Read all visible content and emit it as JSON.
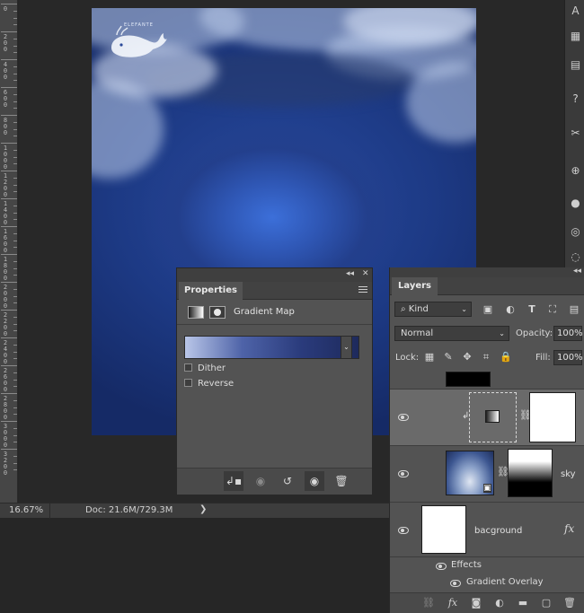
{
  "ruler": {
    "ticks": [
      "0",
      "2 0 0",
      "4 0 0",
      "6 0 0",
      "8 0 0",
      "1 0 0 0",
      "1 2 0 0",
      "1 4 0 0",
      "1 6 0 0",
      "1 8 0 0",
      "2 0 0 0",
      "2 2 0 0",
      "2 4 0 0",
      "2 6 0 0",
      "2 8 0 0",
      "3 0 0 0",
      "3 2 0 0"
    ]
  },
  "canvas": {
    "logo_text": "ELEFANTE"
  },
  "status": {
    "zoom": "16.67%",
    "doc": "Doc: 21.6M/729.3M",
    "arrow": "❯"
  },
  "properties": {
    "tab": "Properties",
    "title": "Gradient Map",
    "collapse": "◂◂",
    "close": "✕",
    "dither": "Dither",
    "reverse": "Reverse",
    "gradient_colors": [
      "#b9c6e8",
      "#4e63a8",
      "#2a3b7c",
      "#1e2a5c"
    ]
  },
  "layers": {
    "tab": "Layers",
    "collapse": "◂◂",
    "filter_kind": "Kind",
    "blend_mode": "Normal",
    "opacity_label": "Opacity:",
    "opacity_value": "100%",
    "lock_label": "Lock:",
    "fill_label": "Fill:",
    "fill_value": "100%",
    "rows": [
      {
        "name": ""
      },
      {
        "name": "sky"
      },
      {
        "name": "bacground",
        "fx": "fx"
      }
    ],
    "effects_label": "Effects",
    "gradient_overlay_label": "Gradient Overlay"
  }
}
